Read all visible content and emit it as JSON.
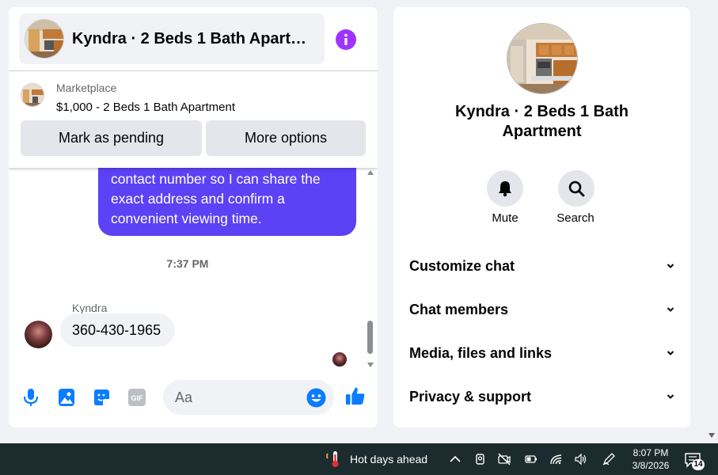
{
  "chat": {
    "title": "Kyndra · 2 Beds 1 Bath Apartment",
    "marketplace": {
      "label": "Marketplace",
      "listing": "$1,000 - 2 Beds 1 Bath Apartment",
      "pending_button": "Mark as pending",
      "more_button": "More options"
    },
    "outgoing_message_lines": [
      "contact number so I can share the",
      "exact address and confirm a",
      "convenient viewing time."
    ],
    "timestamp": "7:37 PM",
    "sender_name": "Kyndra",
    "incoming_message": "360-430-1965",
    "composer": {
      "placeholder": "Aa"
    },
    "colors": {
      "accent": "#a033ff",
      "outgoing_bubble": "#5d41f4",
      "icon_blue": "#0a7cff"
    }
  },
  "info_panel": {
    "title": "Kyndra · 2 Beds 1 Bath Apartment",
    "mute_label": "Mute",
    "search_label": "Search",
    "sections": [
      "Customize chat",
      "Chat members",
      "Media, files and links",
      "Privacy & support"
    ]
  },
  "taskbar": {
    "weather": "Hot days ahead",
    "time": "8:07 PM",
    "date": "3/8/2026",
    "notification_count": "14"
  }
}
